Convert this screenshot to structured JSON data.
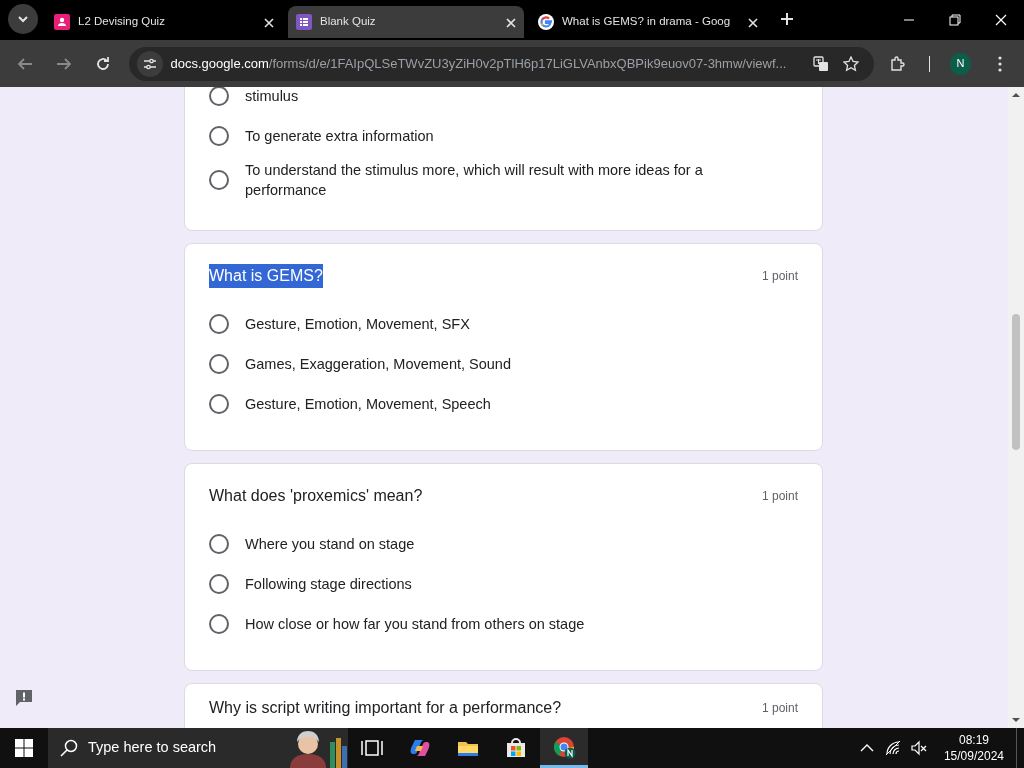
{
  "browser": {
    "tabs": [
      {
        "title": "L2 Devising Quiz",
        "kind": "forms-pink",
        "selected": false
      },
      {
        "title": "Blank Quiz",
        "kind": "forms-purple",
        "selected": true
      },
      {
        "title": "What is GEMS? in drama - Goog",
        "kind": "google",
        "selected": false
      }
    ],
    "url_host": "docs.google.com",
    "url_path": "/forms/d/e/1FAIpQLSeTWvZU3yZiH0v2pTlH6p17LiGLVAnbxQBPik9euov07-3hmw/viewf...",
    "profile": "N"
  },
  "questions": [
    {
      "options": [
        {
          "text": "stimulus",
          "selected": false
        },
        {
          "text": "To generate extra information",
          "selected": false
        },
        {
          "text": "To understand the stimulus more, which will result with more ideas for a performance",
          "selected": false
        }
      ]
    },
    {
      "title": "What is GEMS?",
      "highlighted": true,
      "points": "1 point",
      "options": [
        {
          "text": "Gesture, Emotion, Movement, SFX",
          "selected": false
        },
        {
          "text": "Games, Exaggeration, Movement, Sound",
          "selected": false
        },
        {
          "text": "Gesture, Emotion, Movement, Speech",
          "selected": false
        }
      ]
    },
    {
      "title": "What does 'proxemics' mean?",
      "highlighted": false,
      "points": "1 point",
      "options": [
        {
          "text": "Where you stand on stage",
          "selected": false
        },
        {
          "text": "Following stage directions",
          "selected": false
        },
        {
          "text": "How close or how far you stand from others on stage",
          "selected": false
        }
      ]
    },
    {
      "title": "Why is script writing important for a performance?",
      "highlighted": false,
      "points": "1 point"
    }
  ],
  "taskbar": {
    "search_placeholder": "Type here to search",
    "time": "08:19",
    "date": "15/09/2024"
  }
}
